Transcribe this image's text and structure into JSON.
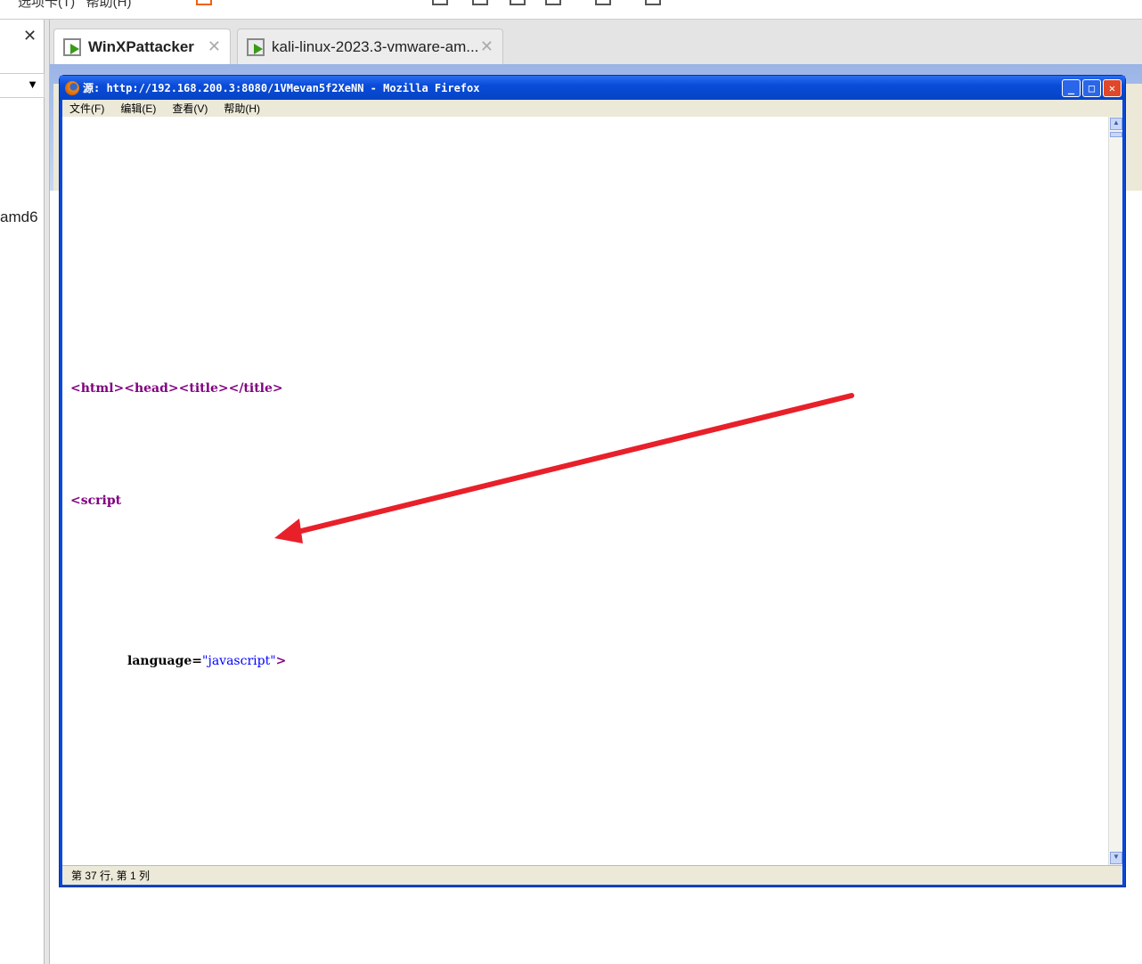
{
  "host": {
    "menus": [
      "选项卡(T)",
      "帮助(H)"
    ],
    "left_panel": {
      "close": "✕",
      "dropdown_arrow": "▼",
      "item_fragment": "amd6"
    },
    "tabs": [
      {
        "label": "WinXPattacker",
        "close": "✕",
        "active": true
      },
      {
        "label": "kali-linux-2023.3-vmware-am...",
        "close": "✕",
        "active": false
      }
    ]
  },
  "firefox": {
    "title": "源: http://192.168.200.3:8080/1VMevan5f2XeNN - Mozilla Firefox",
    "buttons": {
      "minimize": "_",
      "maximize": "□",
      "close": "✕"
    },
    "menu": [
      "文件(F)",
      "编辑(E)",
      "查看(V)",
      "帮助(H)"
    ],
    "source_lines": {
      "line1_tags": "<html><head><title></title>",
      "line2_tag": "<script",
      "line3_attr": "language=",
      "line3_value": "\"javascript\"",
      "line3_close": ">"
    },
    "status": "第 37 行, 第 1 列"
  },
  "annotation": {
    "arrow_color": "#e8202a"
  }
}
